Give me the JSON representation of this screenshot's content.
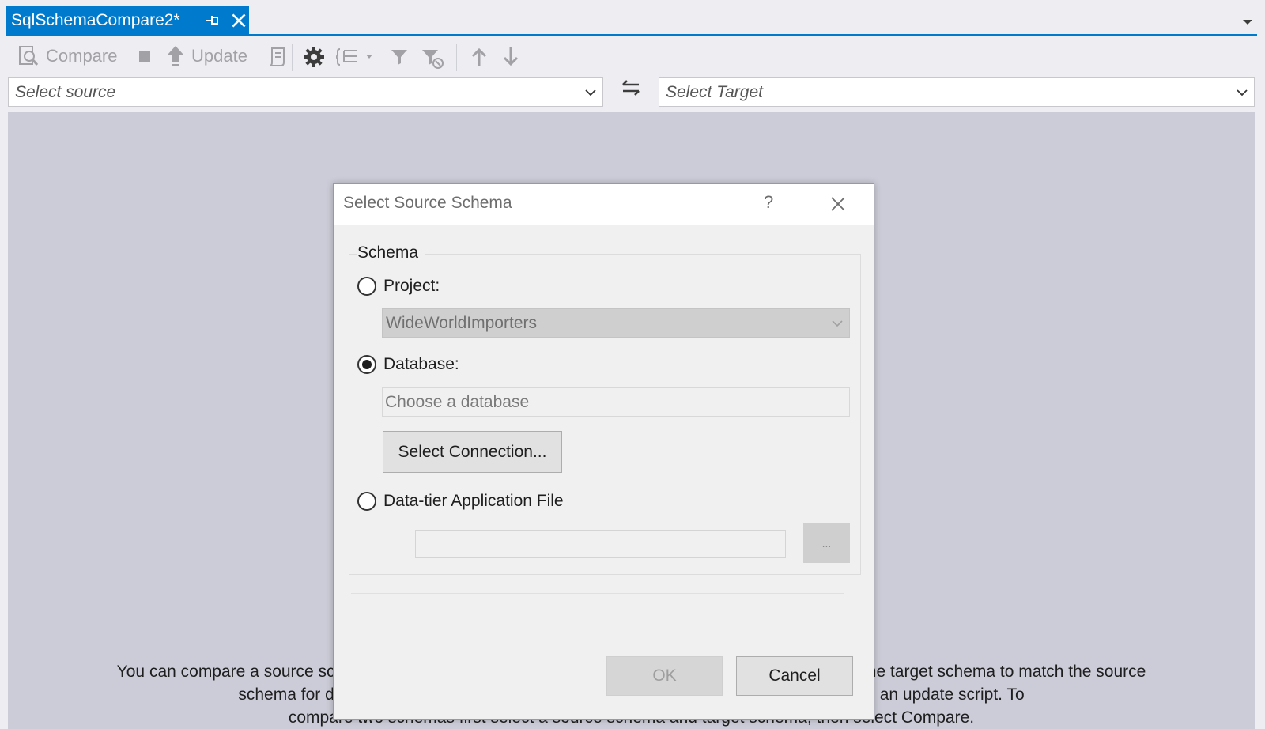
{
  "tab": {
    "title": "SqlSchemaCompare2*"
  },
  "toolbar": {
    "compare_label": "Compare",
    "update_label": "Update",
    "icons": [
      "compare-icon",
      "stop-icon",
      "update-icon",
      "generate-script-icon",
      "options-icon",
      "group-results-icon",
      "filter-icon",
      "clear-filter-icon",
      "previous-change-icon",
      "next-change-icon"
    ]
  },
  "source": {
    "value": "Select source"
  },
  "target": {
    "value": "Select Target"
  },
  "help_text": {
    "line1": "You can compare a source schema with a target schema to see the differences. You can then update the target schema to match the source",
    "line2": "schema for database objects you select. You can update the target directly or generate an update script.  To",
    "line3": "compare two schemas first select a source schema and target schema, then select Compare."
  },
  "dialog": {
    "title": "Select Source Schema",
    "help": "?",
    "group_label": "Schema",
    "project_label": "Project:",
    "project_value": "WideWorldImporters",
    "database_label": "Database:",
    "database_placeholder": "Choose a database",
    "select_connection_label": "Select Connection...",
    "dac_label": "Data-tier Application File",
    "browse_label": "...",
    "ok_label": "OK",
    "cancel_label": "Cancel",
    "selected_option": "database"
  },
  "colors": {
    "accent": "#007acc",
    "pane": "#ccccd8"
  }
}
